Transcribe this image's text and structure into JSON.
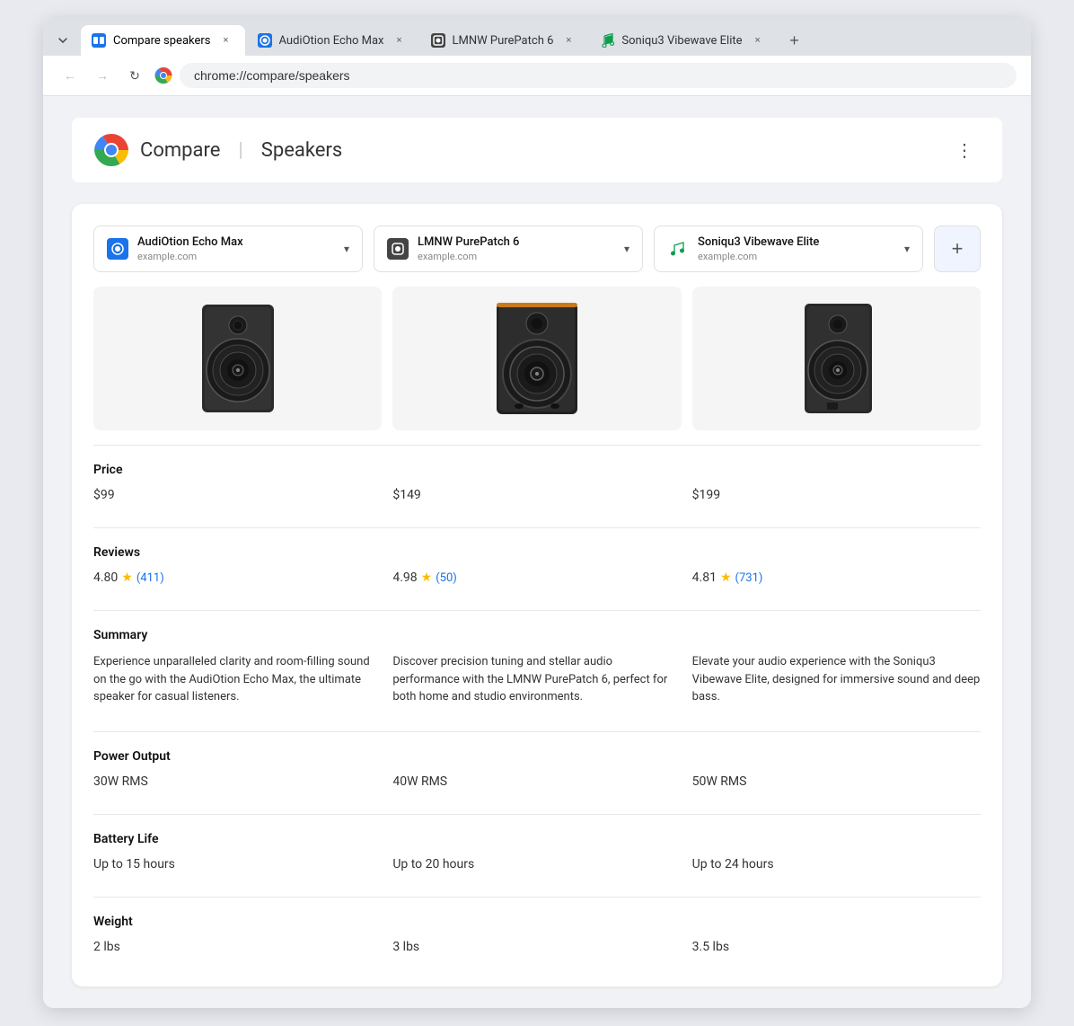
{
  "browser": {
    "tabs": [
      {
        "id": "compare-speakers",
        "label": "Compare speakers",
        "icon_color": "#1a73e8",
        "icon_type": "compare",
        "active": true,
        "url": "chrome://compare/speakers",
        "close_label": "×"
      },
      {
        "id": "audiOtion-echo-max",
        "label": "AudiOtion Echo Max",
        "icon_color": "#1a73e8",
        "icon_type": "product",
        "active": false,
        "close_label": "×"
      },
      {
        "id": "lmnw-purepatch",
        "label": "LMNW PurePatch 6",
        "icon_color": "#333",
        "icon_type": "product",
        "active": false,
        "close_label": "×"
      },
      {
        "id": "soniqu3-vibewave",
        "label": "Soniqu3 Vibewave Elite",
        "icon_color": "#0d9e4e",
        "icon_type": "music",
        "active": false,
        "close_label": "×"
      }
    ],
    "address": "chrome://compare/speakers",
    "new_tab_label": "+"
  },
  "page": {
    "title_compare": "Compare",
    "title_category": "Speakers",
    "more_icon": "⋮"
  },
  "products": [
    {
      "id": "p1",
      "name": "AudiOtion Echo Max",
      "domain": "example.com",
      "icon_color": "#1a73e8",
      "price": "$99",
      "rating": "4.80",
      "review_count": "411",
      "summary": "Experience unparalleled clarity and room-filling sound on the go with the AudiOtion Echo Max, the ultimate speaker for casual listeners.",
      "power_output": "30W RMS",
      "battery_life": "Up to 15 hours",
      "weight": "2 lbs"
    },
    {
      "id": "p2",
      "name": "LMNW PurePatch 6",
      "domain": "example.com",
      "icon_color": "#333",
      "price": "$149",
      "rating": "4.98",
      "review_count": "50",
      "summary": "Discover precision tuning and stellar audio performance with the LMNW PurePatch 6, perfect for both home and studio environments.",
      "power_output": "40W RMS",
      "battery_life": "Up to 20 hours",
      "weight": "3 lbs"
    },
    {
      "id": "p3",
      "name": "Soniqu3 Vibewave Elite",
      "domain": "example.com",
      "icon_color": "#0d9e4e",
      "price": "$199",
      "rating": "4.81",
      "review_count": "731",
      "summary": "Elevate your audio experience with the Soniqu3 Vibewave Elite, designed for immersive sound and deep bass.",
      "power_output": "50W RMS",
      "battery_life": "Up to 24 hours",
      "weight": "3.5 lbs"
    }
  ],
  "comparison_rows": [
    {
      "label": "Price",
      "field": "price"
    },
    {
      "label": "Reviews",
      "field": "reviews"
    },
    {
      "label": "Summary",
      "field": "summary"
    },
    {
      "label": "Power Output",
      "field": "power_output"
    },
    {
      "label": "Battery Life",
      "field": "battery_life"
    },
    {
      "label": "Weight",
      "field": "weight"
    }
  ],
  "labels": {
    "add_product": "+",
    "dropdown_arrow": "▾",
    "star": "★",
    "nav_back": "←",
    "nav_forward": "→",
    "nav_reload": "↻"
  }
}
